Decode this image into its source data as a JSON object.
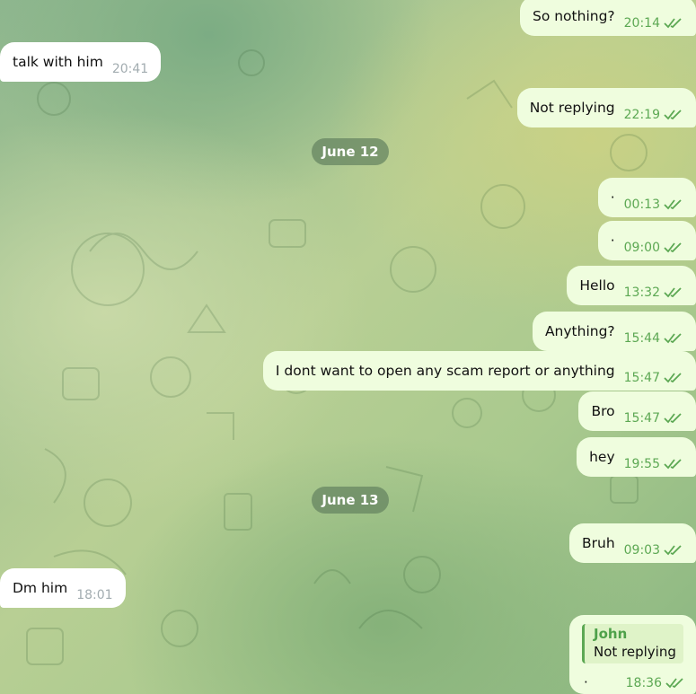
{
  "chat": {
    "colors": {
      "outgoing_bubble": "#effdde",
      "incoming_bubble": "#ffffff",
      "time_out": "#5ca853",
      "date_pill": "#64825f"
    },
    "messages": [
      {
        "dir": "out",
        "text": "So nothing?",
        "time": "20:14"
      },
      {
        "dir": "in",
        "text": "talk with him",
        "time": "20:41"
      },
      {
        "dir": "out",
        "text": "Not replying",
        "time": "22:19"
      },
      {
        "dir": "out",
        "text": "·",
        "time": "00:13"
      },
      {
        "dir": "out",
        "text": "·",
        "time": "09:00"
      },
      {
        "dir": "out",
        "text": "Hello",
        "time": "13:32"
      },
      {
        "dir": "out",
        "text": "Anything?",
        "time": "15:44"
      },
      {
        "dir": "out",
        "text": "I dont want to open any scam report or anything",
        "time": "15:47"
      },
      {
        "dir": "out",
        "text": "Bro",
        "time": "15:47"
      },
      {
        "dir": "out",
        "text": "hey",
        "time": "19:55"
      },
      {
        "dir": "out",
        "text": "Bruh",
        "time": "09:03"
      },
      {
        "dir": "in",
        "text": "Dm him",
        "time": "18:01"
      }
    ],
    "dates": [
      "June 12",
      "June 13"
    ],
    "reply": {
      "quote_author": "John",
      "quote_text": "Not replying",
      "text": "·",
      "time": "18:36"
    }
  }
}
